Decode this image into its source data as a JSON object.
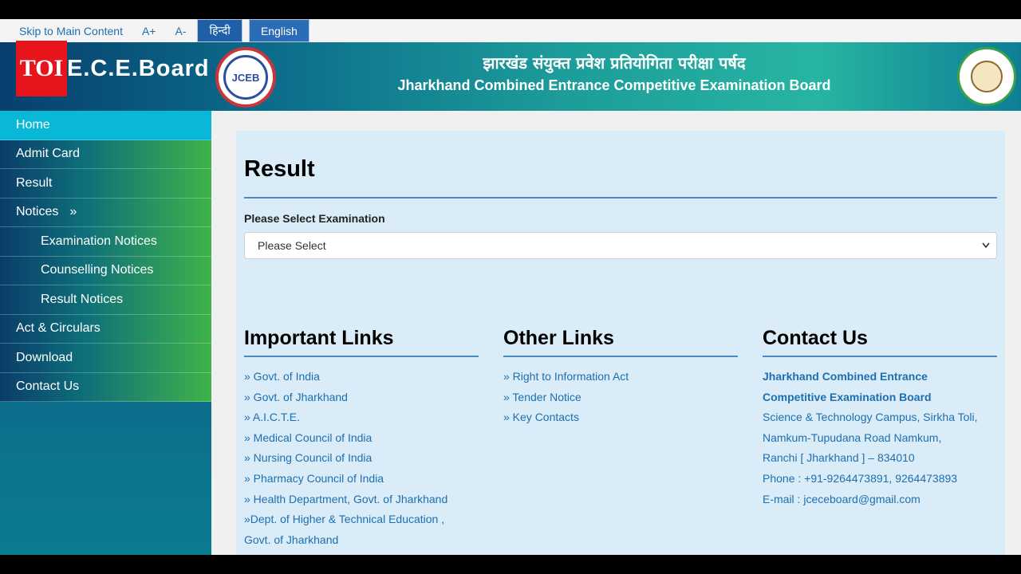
{
  "topbar": {
    "skip": "Skip to Main Content",
    "font_increase": "A+",
    "font_decrease": "A-",
    "lang_hindi": "हिन्दी",
    "lang_english": "English"
  },
  "header": {
    "toi_logo": "TOI",
    "brand": "E.C.E.Board",
    "seal_text": "JCEB",
    "title_hindi": "झारखंड संयुक्त प्रवेश प्रतियोगिता परीक्षा पर्षद",
    "title_english": "Jharkhand Combined Entrance Competitive Examination Board"
  },
  "sidebar": {
    "items": [
      {
        "label": "Home"
      },
      {
        "label": "Admit Card"
      },
      {
        "label": "Result"
      },
      {
        "label": "Notices",
        "arrow": "»"
      },
      {
        "label": "Examination Notices"
      },
      {
        "label": "Counselling Notices"
      },
      {
        "label": "Result Notices"
      },
      {
        "label": "Act & Circulars"
      },
      {
        "label": "Download"
      },
      {
        "label": "Contact Us"
      }
    ]
  },
  "main": {
    "title": "Result",
    "select_label": "Please Select Examination",
    "select_value": "Please Select"
  },
  "important_links": {
    "heading": "Important Links",
    "items": [
      "» Govt. of India",
      "» Govt. of Jharkhand",
      "» A.I.C.T.E.",
      "» Medical Council of India",
      "» Nursing Council of India",
      "» Pharmacy Council of India",
      "» Health Department, Govt. of Jharkhand",
      "»Dept. of Higher & Technical Education ,",
      "Govt. of Jharkhand"
    ]
  },
  "other_links": {
    "heading": "Other Links",
    "items": [
      "» Right to Information Act",
      "» Tender Notice",
      "» Key Contacts"
    ]
  },
  "contact": {
    "heading": "Contact Us",
    "org_line1": "Jharkhand Combined Entrance",
    "org_line2": "Competitive Examination Board",
    "addr1": "Science & Technology Campus, Sirkha Toli,",
    "addr2": "Namkum-Tupudana Road Namkum,",
    "addr3": "Ranchi [ Jharkhand ] – 834010",
    "phone": "Phone : +91-9264473891, 9264473893",
    "email": "E-mail : jceceboard@gmail.com"
  },
  "colors": {
    "link": "#1e6fb0",
    "active_nav": "#09b8d6",
    "content_bg": "#d9ecf8",
    "toi_red": "#e8141c"
  }
}
